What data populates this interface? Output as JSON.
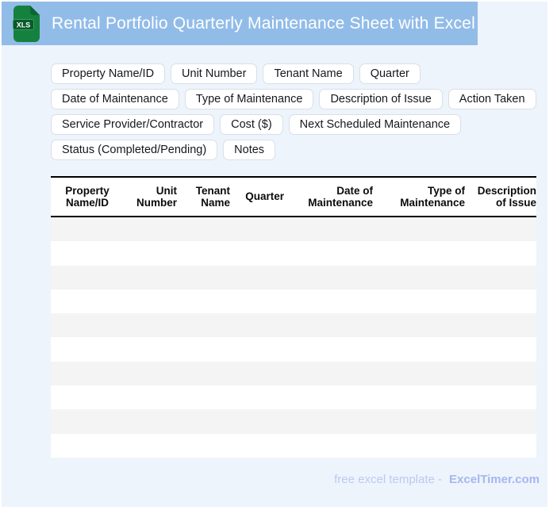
{
  "header": {
    "title": "Rental Portfolio Quarterly Maintenance Sheet with Excel",
    "icon_label": "XLS"
  },
  "tags": {
    "items": [
      "Property Name/ID",
      "Unit Number",
      "Tenant Name",
      "Quarter",
      "Date of Maintenance",
      "Type of Maintenance",
      "Description of Issue",
      "Action Taken",
      "Service Provider/Contractor",
      "Cost ($)",
      "Next Scheduled Maintenance",
      "Status (Completed/Pending)",
      "Notes"
    ]
  },
  "table": {
    "columns": [
      "Property Name/ID",
      "Unit Number",
      "Tenant Name",
      "Quarter",
      "Date of Maintenance",
      "Type of Maintenance",
      "Description of Issue"
    ],
    "empty_row_count": 10
  },
  "footer": {
    "prefix": "free excel template -",
    "brand": "ExcelTimer.com"
  },
  "colors": {
    "title_bar": "#92bce8",
    "page_background": "#edf4fc",
    "icon_green": "#15813e",
    "icon_fold_green": "#0c6433",
    "icon_badge_green": "#0a5a2b",
    "row_stripe": "#f4f4f4",
    "header_border": "#000000",
    "footer_text": "#bdc9f2",
    "footer_brand": "#a6b7ee"
  }
}
